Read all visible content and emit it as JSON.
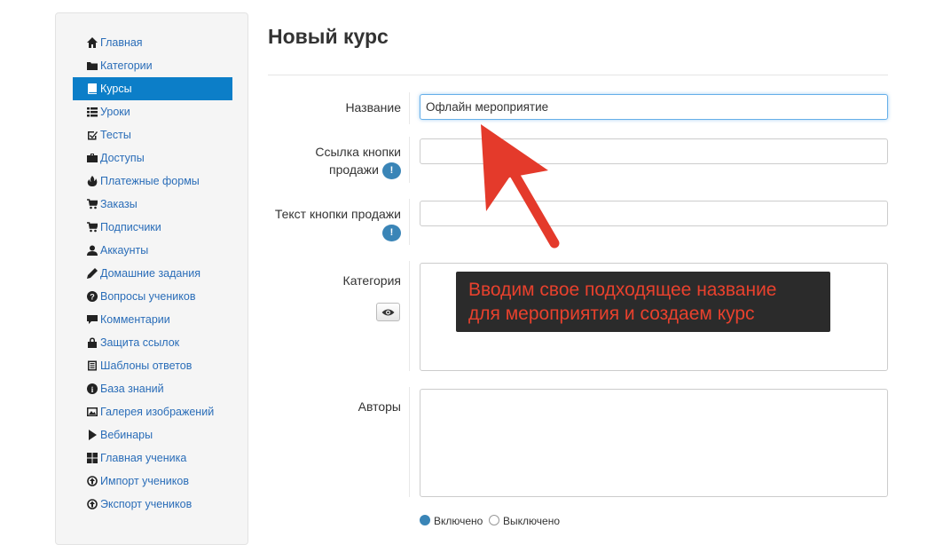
{
  "sidebar": {
    "items": [
      {
        "label": "Главная",
        "icon": "home-icon"
      },
      {
        "label": "Категории",
        "icon": "folder-icon"
      },
      {
        "label": "Курсы",
        "icon": "book-icon",
        "active": true
      },
      {
        "label": "Уроки",
        "icon": "list-icon"
      },
      {
        "label": "Тесты",
        "icon": "check-edit-icon"
      },
      {
        "label": "Доступы",
        "icon": "briefcase-icon"
      },
      {
        "label": "Платежные формы",
        "icon": "fire-icon"
      },
      {
        "label": "Заказы",
        "icon": "cart-icon"
      },
      {
        "label": "Подписчики",
        "icon": "cart-icon"
      },
      {
        "label": "Аккаунты",
        "icon": "user-icon"
      },
      {
        "label": "Домашние задания",
        "icon": "pencil-icon"
      },
      {
        "label": "Вопросы учеников",
        "icon": "question-icon"
      },
      {
        "label": "Комментарии",
        "icon": "comment-icon"
      },
      {
        "label": "Защита ссылок",
        "icon": "lock-icon"
      },
      {
        "label": "Шаблоны ответов",
        "icon": "template-icon"
      },
      {
        "label": "База знаний",
        "icon": "info-icon"
      },
      {
        "label": "Галерея изображений",
        "icon": "picture-icon"
      },
      {
        "label": "Вебинары",
        "icon": "play-icon"
      },
      {
        "label": "Главная ученика",
        "icon": "grid-icon"
      },
      {
        "label": "Импорт учеников",
        "icon": "circle-arrow-icon"
      },
      {
        "label": "Экспорт учеников",
        "icon": "circle-arrow-icon"
      }
    ]
  },
  "page": {
    "title": "Новый курс"
  },
  "form": {
    "name_label": "Название",
    "name_value": "Офлайн мероприятие",
    "sale_link_label_1": "Ссылка кнопки",
    "sale_link_label_2": "продажи",
    "sale_text_label": "Текст кнопки продажи",
    "category_label": "Категория",
    "authors_label": "Авторы",
    "hint_symbol": "!",
    "radio_1": "Включено",
    "radio_2": "Выключено"
  },
  "callout": {
    "line1": "Вводим свое подходящее название",
    "line2": "для мероприятия и создаем курс"
  },
  "colors": {
    "active_nav": "#0c7ec8",
    "link": "#2a6db8",
    "arrow": "#e43a2b",
    "callout_bg": "#2b2b2b"
  }
}
